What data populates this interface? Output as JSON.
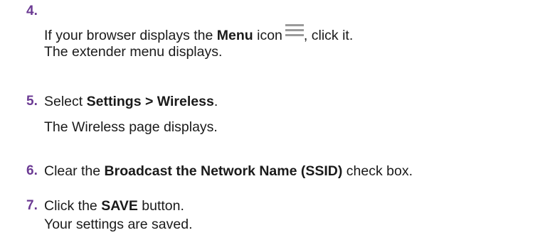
{
  "steps": [
    {
      "number": "4.",
      "lines": [
        {
          "before": "If your browser displays the ",
          "bold": "Menu",
          "after_bold": " icon",
          "icon": "menu-icon",
          "after_icon": ", click it."
        },
        {
          "text": "The extender menu displays."
        }
      ]
    },
    {
      "number": "5.",
      "lines": [
        {
          "before": "Select ",
          "bold": "Settings > Wireless",
          "after": "."
        },
        {
          "text": "The Wireless page displays."
        }
      ]
    },
    {
      "number": "6.",
      "lines": [
        {
          "before": "Clear the ",
          "bold": "Broadcast the Network Name (SSID)",
          "after": " check box."
        }
      ]
    },
    {
      "number": "7.",
      "lines": [
        {
          "before": "Click the ",
          "bold": "SAVE",
          "after": " button."
        },
        {
          "text": "Your settings are saved."
        }
      ]
    }
  ],
  "colors": {
    "step_number": "#6b3a93",
    "text": "#1a1a1a",
    "menu_icon": "#9a9a9a"
  }
}
